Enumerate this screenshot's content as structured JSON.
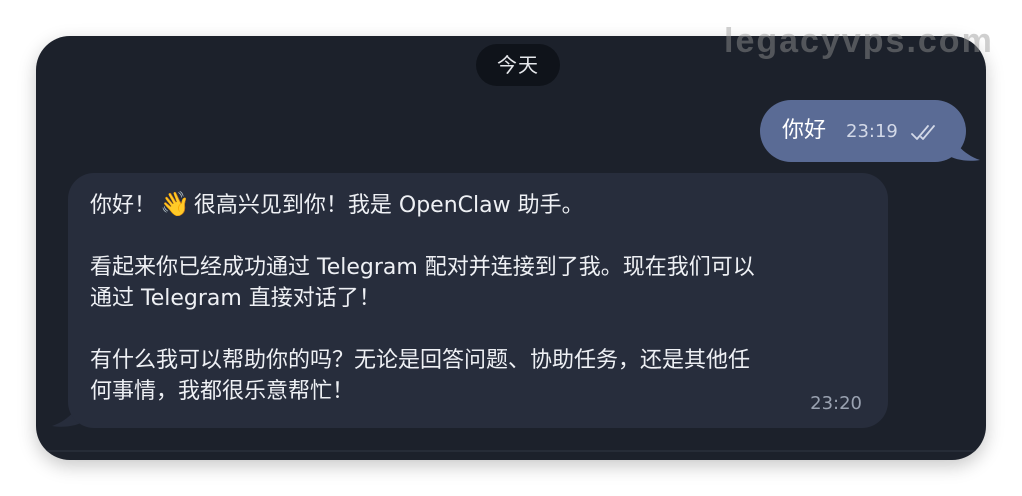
{
  "watermark": "legacyvps.com",
  "date_divider": "今天",
  "outgoing": {
    "text": "你好",
    "time": "23:19",
    "status_icon": "double-check-icon"
  },
  "incoming": {
    "line1_pre": "你好！",
    "emoji": "👋",
    "line1_post": "很高兴见到你！我是 OpenClaw 助手。",
    "line2": "看起来你已经成功通过 Telegram 配对并连接到了我。现在我们可以",
    "line3": "通过 Telegram 直接对话了！",
    "line4": "有什么我可以帮助你的吗？无论是回答问题、协助任务，还是其他任",
    "line5": "何事情，我都很乐意帮忙！",
    "time": "23:20"
  },
  "colors": {
    "window_bg": "#1c212b",
    "outgoing_bubble": "#5a6b95",
    "incoming_bubble": "#272d3c",
    "date_pill": "#0f131a"
  }
}
